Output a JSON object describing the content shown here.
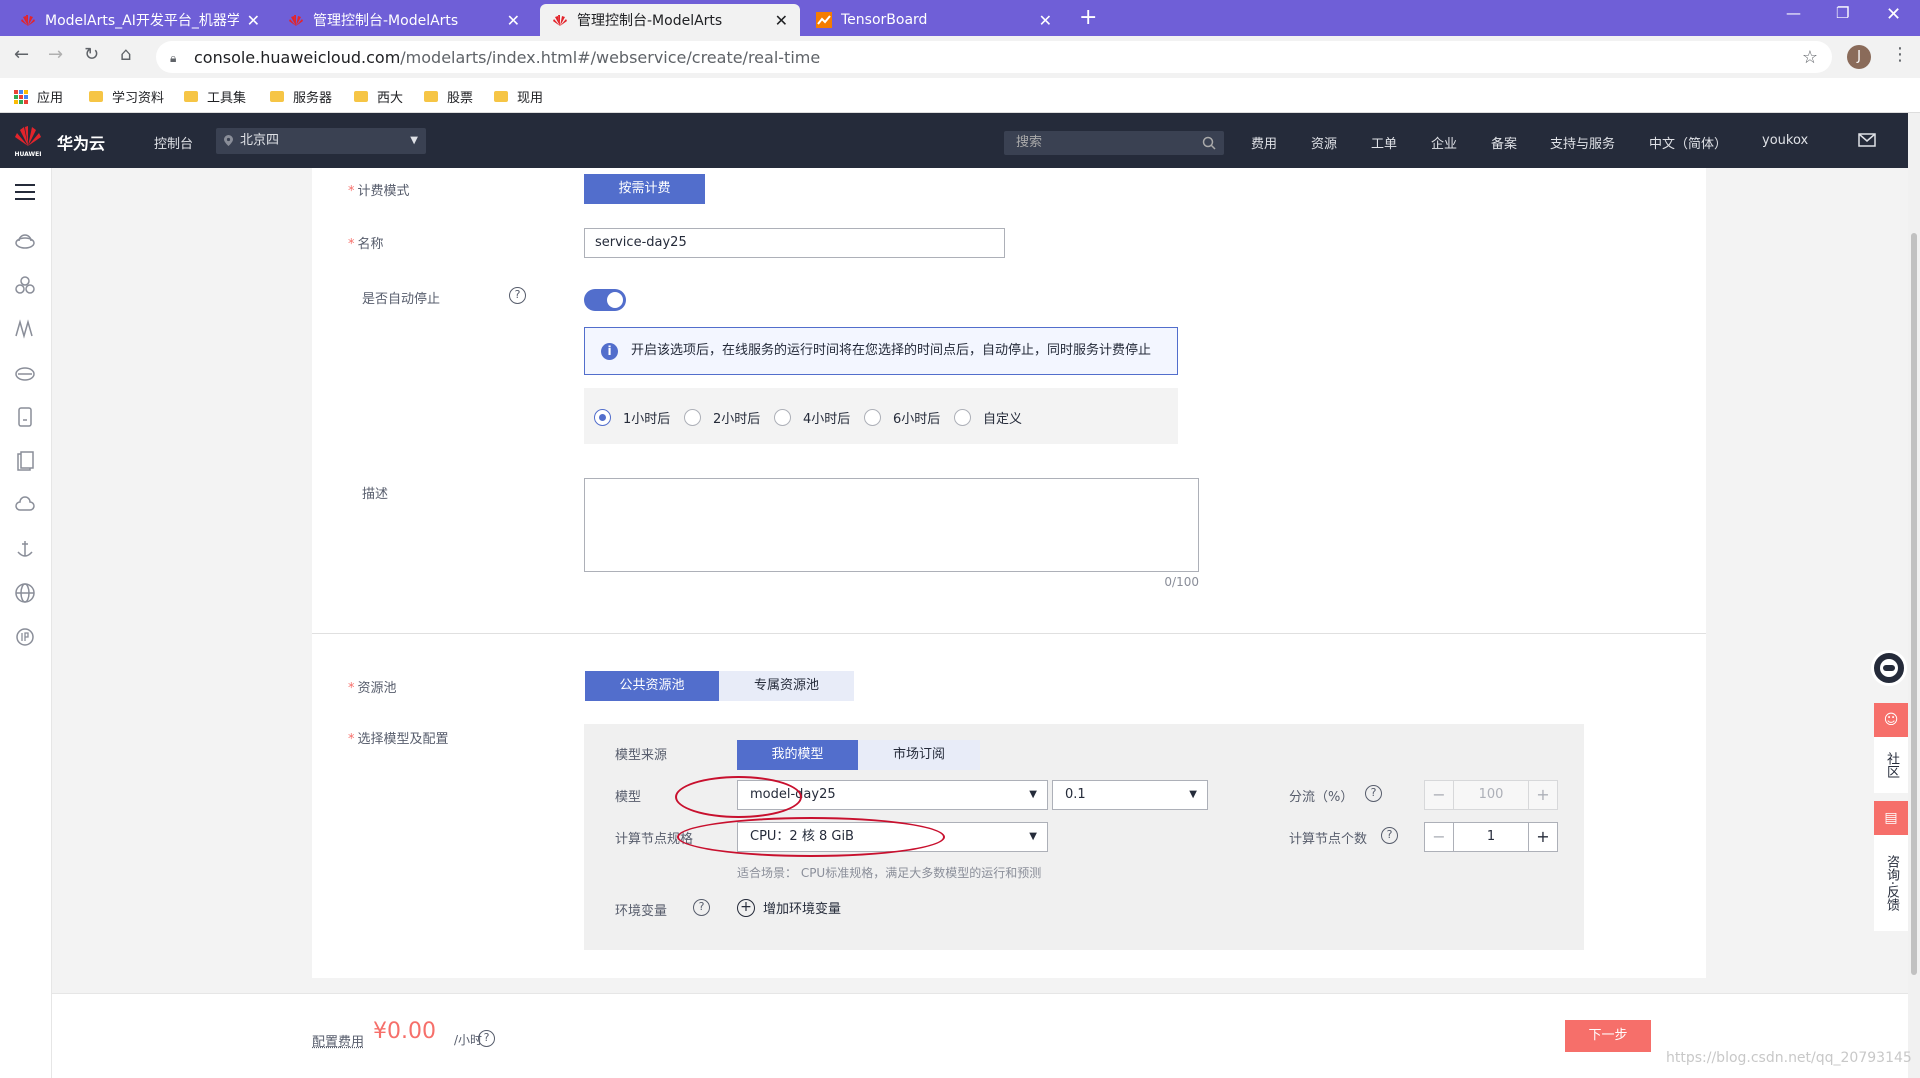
{
  "browser": {
    "tabs": [
      {
        "title": "ModelArts_AI开发平台_机器学习",
        "active": false
      },
      {
        "title": "管理控制台-ModelArts",
        "active": false
      },
      {
        "title": "管理控制台-ModelArts",
        "active": true
      },
      {
        "title": "TensorBoard",
        "active": false
      }
    ],
    "url_host": "console.huaweicloud.com",
    "url_path": "/modelarts/index.html#/webservice/create/real-time",
    "avatar_letter": "J",
    "bookmarks": [
      "应用",
      "学习资料",
      "工具集",
      "服务器",
      "西大",
      "股票",
      "现用"
    ]
  },
  "topnav": {
    "brand": "华为云",
    "logo_text": "HUAWEI",
    "console": "控制台",
    "region": "北京四",
    "search_placeholder": "搜索",
    "items": [
      "费用",
      "资源",
      "工单",
      "企业",
      "备案",
      "支持与服务",
      "中文（简体）",
      "youkox"
    ]
  },
  "form": {
    "billing_label": "计费模式",
    "billing_value": "按需计费",
    "name_label": "名称",
    "name_value": "service-day25",
    "autostop_label": "是否自动停止",
    "autostop_on": true,
    "info_text": "开启该选项后，在线服务的运行时间将在您选择的时间点后，自动停止，同时服务计费停止",
    "stop_options": [
      "1小时后",
      "2小时后",
      "4小时后",
      "6小时后",
      "自定义"
    ],
    "stop_selected": 0,
    "desc_label": "描述",
    "desc_counter": "0/100",
    "pool_label": "资源池",
    "pool_options": [
      "公共资源池",
      "专属资源池"
    ],
    "model_config_label": "选择模型及配置",
    "model_source_label": "模型来源",
    "model_source_options": [
      "我的模型",
      "市场订阅"
    ],
    "model_label": "模型",
    "model_value": "model-day25",
    "version_value": "0.1",
    "traffic_label": "分流（%）",
    "traffic_value": "100",
    "spec_label": "计算节点规格",
    "spec_value": "CPU：2 核 8 GiB",
    "node_count_label": "计算节点个数",
    "node_count_value": "1",
    "scenario_text": "适合场景： CPU标准规格，满足大多数模型的运行和预测",
    "env_label": "环境变量",
    "env_add": "增加环境变量"
  },
  "footer": {
    "cost_label": "配置费用",
    "cost_value": "¥0.00",
    "cost_unit": "/小时",
    "next": "下一步"
  },
  "float": {
    "community": "社区",
    "feedback": "咨询·反馈"
  },
  "watermark": "https://blog.csdn.net/qq_20793145",
  "colors": {
    "tabbar": "#6f5fd7",
    "topnav": "#252b3a",
    "primary": "#526ecc",
    "danger": "#f66f6a"
  }
}
